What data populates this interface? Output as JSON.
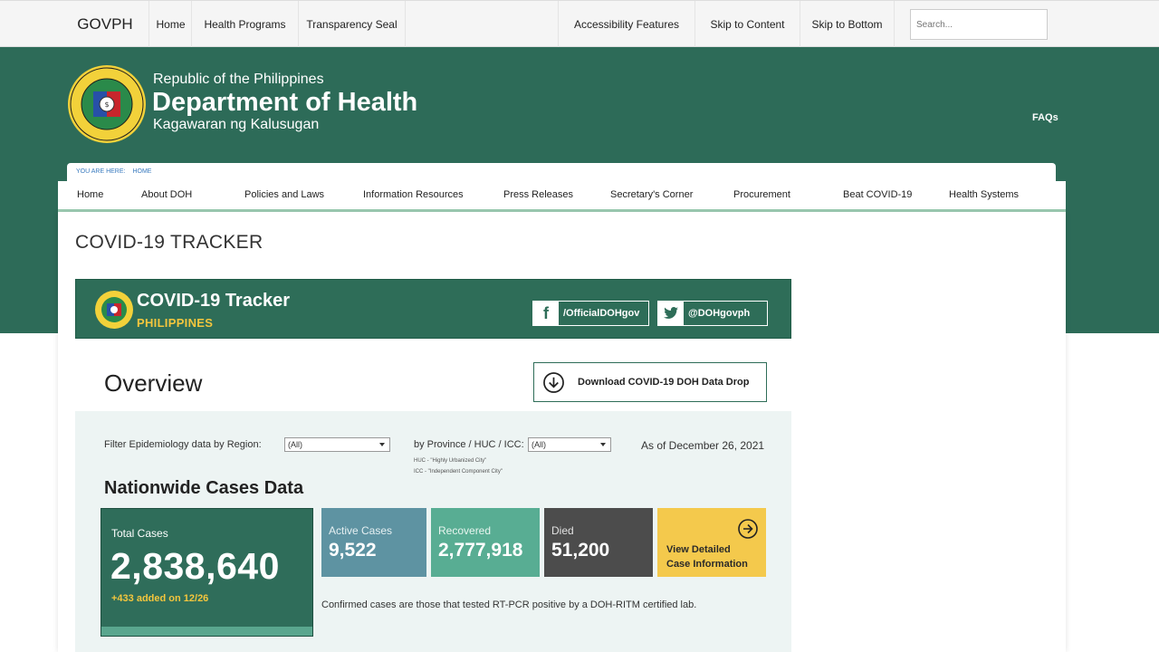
{
  "topbar": {
    "brand": "GOVPH",
    "links_left": [
      "Home",
      "Health Programs",
      "Transparency Seal"
    ],
    "links_right": [
      "Accessibility Features",
      "Skip to Content",
      "Skip to Bottom"
    ],
    "search_placeholder": "Search..."
  },
  "header": {
    "line1": "Republic of the Philippines",
    "line2": "Department of Health",
    "line3": "Kagawaran ng Kalusugan",
    "faqs": "FAQs",
    "seal_text": "REPUBLIC OF THE PHILIPPINES · DEPARTMENT OF HEALTH"
  },
  "breadcrumb": {
    "you_are_here": "YOU ARE HERE:",
    "home": "HOME"
  },
  "nav": [
    "Home",
    "About DOH",
    "Policies and Laws",
    "Information Resources",
    "Press Releases",
    "Secretary's Corner",
    "Procurement",
    "Beat COVID-19",
    "Health Systems"
  ],
  "page_title": "COVID-19 TRACKER",
  "banner": {
    "title": "COVID-19 Tracker",
    "subtitle": "PHILIPPINES",
    "facebook": "/OfficialDOHgov",
    "twitter": "@DOHgovph"
  },
  "overview": {
    "heading": "Overview",
    "download_label": "Download COVID-19 DOH Data Drop"
  },
  "filters": {
    "region_label": "Filter Epidemiology data by Region:",
    "region_value": "(All)",
    "province_label": "by Province / HUC / ICC:",
    "province_value": "(All)",
    "huc_note": "HUC - \"Highly Urbanized City\"",
    "icc_note": "ICC - \"Independent Component City\"",
    "as_of": "As of December 26, 2021"
  },
  "cases": {
    "heading": "Nationwide Cases Data",
    "total_label": "Total Cases",
    "total_value": "2,838,640",
    "total_added": "+433 added on 12/26",
    "active_label": "Active Cases",
    "active_value": "9,522",
    "recovered_label": "Recovered",
    "recovered_value": "2,777,918",
    "died_label": "Died",
    "died_value": "51,200",
    "view_detailed_1": "View Detailed",
    "view_detailed_2": "Case Information",
    "confirmed_note": "Confirmed cases are those that tested RT-PCR positive by a DOH-RITM certified lab."
  },
  "colors": {
    "header_green": "#2d6b58",
    "accent_yellow": "#f4c63d",
    "active_blue": "#5e93a2",
    "recovered_green": "#58ad93",
    "died_gray": "#4c4c4c",
    "detail_yellow": "#f4c94c"
  }
}
